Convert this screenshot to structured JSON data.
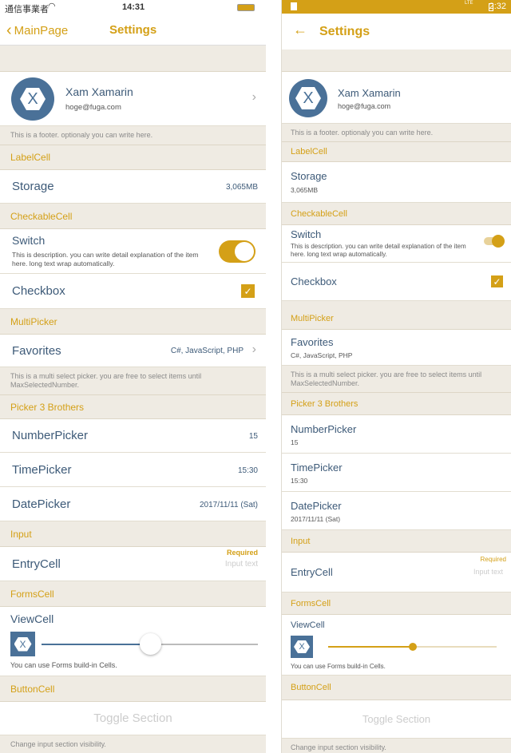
{
  "ios": {
    "status": {
      "carrier": "通信事業者",
      "time": "14:31"
    },
    "nav": {
      "back": "MainPage",
      "title": "Settings"
    }
  },
  "android": {
    "status": {
      "time": "2:32",
      "network": "LTE"
    },
    "nav": {
      "title": "Settings"
    }
  },
  "profile": {
    "name": "Xam Xamarin",
    "email": "hoge@fuga.com",
    "footer": "This is a footer. optionaly you can write here."
  },
  "label_section": {
    "header": "LabelCell",
    "storage_label": "Storage",
    "storage_value": "3,065MB"
  },
  "checkable_section": {
    "header": "CheckableCell",
    "switch_label": "Switch",
    "switch_desc": "This is description. you can write detail explanation of the item here. long text wrap automatically.",
    "switch_on": true,
    "checkbox_label": "Checkbox",
    "checkbox_checked": true
  },
  "multipicker_section": {
    "header": "MultiPicker",
    "favorites_label": "Favorites",
    "favorites_value": "C#, JavaScript, PHP",
    "footer": "This is a multi select picker. you are free to select items until MaxSelectedNumber."
  },
  "picker_section": {
    "header": "Picker 3 Brothers",
    "number_label": "NumberPicker",
    "number_value": "15",
    "time_label": "TimePicker",
    "time_value": "15:30",
    "date_label": "DatePicker",
    "date_value": "2017/11/11 (Sat)"
  },
  "input_section": {
    "header": "Input",
    "entry_label": "EntryCell",
    "required": "Required",
    "placeholder": "Input text"
  },
  "forms_section": {
    "header": "FormsCell",
    "viewcell_label": "ViewCell",
    "ios_slider_value": 0.5,
    "android_slider_value": 0.5,
    "desc": "You can use Forms build-in Cells."
  },
  "button_section": {
    "header": "ButtonCell",
    "button_label": "Toggle Section",
    "footer": "Change input section visibility."
  },
  "colors": {
    "accent": "#d4a017",
    "text": "#3d5a78",
    "section_bg": "#efebe3"
  }
}
